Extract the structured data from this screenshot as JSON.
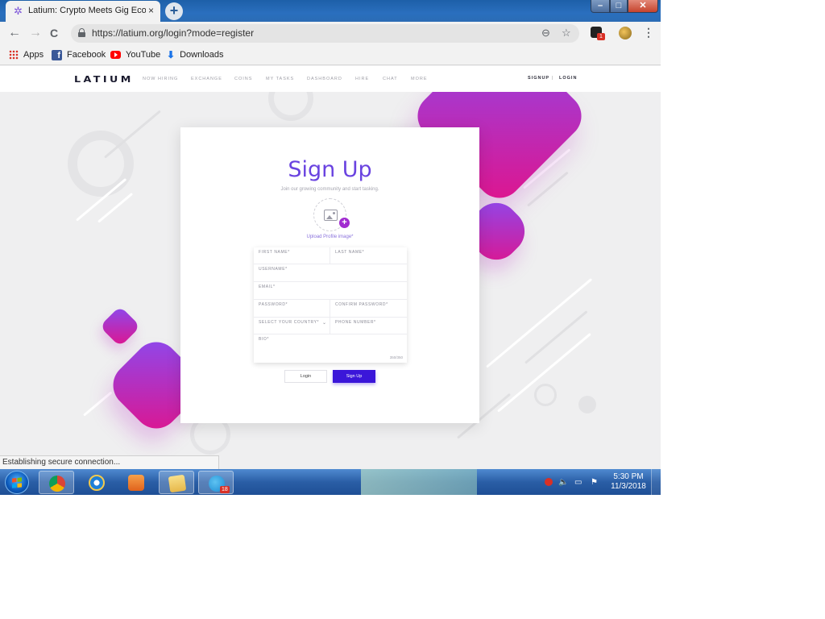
{
  "browser": {
    "tab_title": "Latium: Crypto Meets Gig Econo",
    "tab_close": "×",
    "new_tab": "+",
    "url": "https://latium.org/login?mode=register",
    "extension_badge": "1",
    "back": "←",
    "forward": "→",
    "reload": "C",
    "zoom_glyph": "⊖",
    "star_glyph": "☆",
    "menu_glyph": "⋮",
    "window_min": "–",
    "window_max": "□",
    "window_close": "✕"
  },
  "bookmarks": [
    {
      "label": "Apps",
      "icon": "apps-grid-icon"
    },
    {
      "label": "Facebook",
      "icon": "facebook-icon"
    },
    {
      "label": "YouTube",
      "icon": "youtube-icon"
    },
    {
      "label": "Downloads",
      "icon": "download-icon"
    }
  ],
  "site": {
    "logo": "LATIUM",
    "nav": [
      "NOW HIRING",
      "EXCHANGE",
      "COINS",
      "MY TASKS",
      "DASHBOARD",
      "HIRE",
      "CHAT",
      "MORE"
    ],
    "signup": "SIGNUP",
    "separator": "|",
    "login": "LOGIN"
  },
  "form": {
    "title": "Sign Up",
    "subtitle": "Join our growing community and start tasking.",
    "upload_label": "Upload Profile image*",
    "plus": "+",
    "fields": {
      "first_name": "FIRST NAME*",
      "last_name": "LAST NAME*",
      "username": "USERNAME*",
      "email": "EMAIL*",
      "password": "PASSWORD*",
      "confirm_password": "CONFIRM PASSWORD*",
      "country": "SELECT YOUR COUNTRY*",
      "phone": "PHONE NUMBER*",
      "bio": "BIO*"
    },
    "bio_counter": "350/350",
    "login_button": "Login",
    "signup_button": "Sign Up"
  },
  "status": "Establishing secure connection...",
  "taskbar": {
    "telegram_badge": "18",
    "time": "5:30 PM",
    "date": "11/3/2018"
  },
  "colors": {
    "accent": "#6a43e0",
    "button": "#3b16d9",
    "gradient_start": "#8a4af0",
    "gradient_end": "#e0148c"
  }
}
